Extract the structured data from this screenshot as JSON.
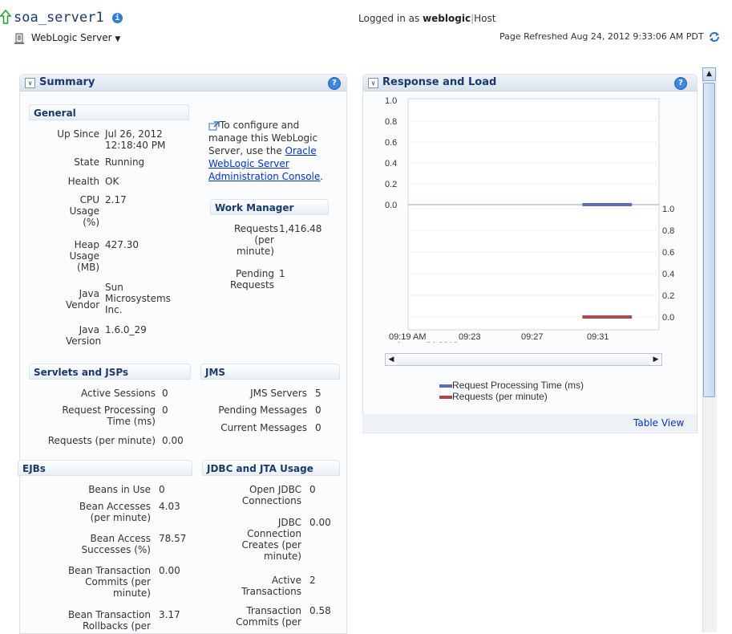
{
  "header": {
    "server_name": "soa_server1",
    "server_menu_label": "WebLogic Server",
    "logged_in_prefix": "Logged in as",
    "user": "weblogic",
    "host_label": "Host",
    "page_refreshed": "Page Refreshed Aug 24, 2012 9:33:06 AM PDT"
  },
  "summary": {
    "title": "Summary",
    "general": {
      "title": "General",
      "rows": [
        {
          "label": "Up Since",
          "value": "Jul 26, 2012 12:18:40 PM"
        },
        {
          "label": "State",
          "value": "Running"
        },
        {
          "label": "Health",
          "value": "OK"
        },
        {
          "label": "CPU Usage (%)",
          "value": "2.17"
        },
        {
          "label": "Heap Usage (MB)",
          "value": "427.30"
        },
        {
          "label": "Java Vendor",
          "value": "Sun Microsystems Inc."
        },
        {
          "label": "Java Version",
          "value": "1.6.0_29"
        }
      ]
    },
    "configure": {
      "text1": "To configure and manage this WebLogic Server, use the ",
      "link": "Oracle WebLogic Server Administration Console",
      "text2": "."
    },
    "work_manager": {
      "title": "Work Manager",
      "rows": [
        {
          "label": "Requests (per minute)",
          "value": "1,416.48"
        },
        {
          "label": "Pending Requests",
          "value": "1"
        }
      ]
    },
    "servlets": {
      "title": "Servlets and JSPs",
      "rows": [
        {
          "label": "Active Sessions",
          "value": "0"
        },
        {
          "label": "Request Processing Time (ms)",
          "value": "0"
        },
        {
          "label": "Requests (per minute)",
          "value": "0.00"
        }
      ]
    },
    "jms": {
      "title": "JMS",
      "rows": [
        {
          "label": "JMS Servers",
          "value": "5"
        },
        {
          "label": "Pending Messages",
          "value": "0"
        },
        {
          "label": "Current Messages",
          "value": "0"
        }
      ]
    },
    "ejbs": {
      "title": "EJBs",
      "rows": [
        {
          "label": "Beans in Use",
          "value": "0"
        },
        {
          "label": "Bean Accesses (per minute)",
          "value": "4.03"
        },
        {
          "label": "Bean Access Successes (%)",
          "value": "78.57"
        },
        {
          "label": "Bean Transaction Commits (per minute)",
          "value": "0.00"
        },
        {
          "label": "Bean Transaction Rollbacks (per",
          "value": "3.17"
        }
      ]
    },
    "jdbc": {
      "title": "JDBC and JTA Usage",
      "rows": [
        {
          "label": "Open JDBC Connections",
          "value": "0"
        },
        {
          "label": "JDBC Connection Creates (per minute)",
          "value": "0.00"
        },
        {
          "label": "Active Transactions",
          "value": "2"
        },
        {
          "label": "Transaction Commits (per",
          "value": "0.58"
        }
      ]
    }
  },
  "response": {
    "title": "Response and Load",
    "table_view": "Table View",
    "legend": [
      "Request Processing Time (ms)",
      "Requests (per minute)"
    ],
    "chart_data": {
      "type": "line",
      "x_ticks": [
        "09:19 AM",
        "09:23",
        "09:27",
        "09:31"
      ],
      "x_subtitle": "August 24 2012",
      "y_left_ticks": [
        "1.0",
        "0.8",
        "0.6",
        "0.4",
        "0.2",
        "0.0"
      ],
      "y_right_ticks": [
        "1.0",
        "0.8",
        "0.6",
        "0.4",
        "0.2",
        "0.0"
      ],
      "series": [
        {
          "name": "Request Processing Time (ms)",
          "color": "#5b6eb5",
          "x": [
            "09:30",
            "09:33"
          ],
          "values": [
            0.0,
            0.0
          ]
        },
        {
          "name": "Requests (per minute)",
          "color": "#b5474a",
          "x": [
            "09:30",
            "09:33"
          ],
          "values": [
            0.0,
            0.0
          ]
        }
      ]
    }
  },
  "icons": [
    "up-arrow-icon",
    "info-icon",
    "server-icon",
    "refresh-icon",
    "help-icon",
    "external-link-icon",
    "collapse-icon"
  ]
}
